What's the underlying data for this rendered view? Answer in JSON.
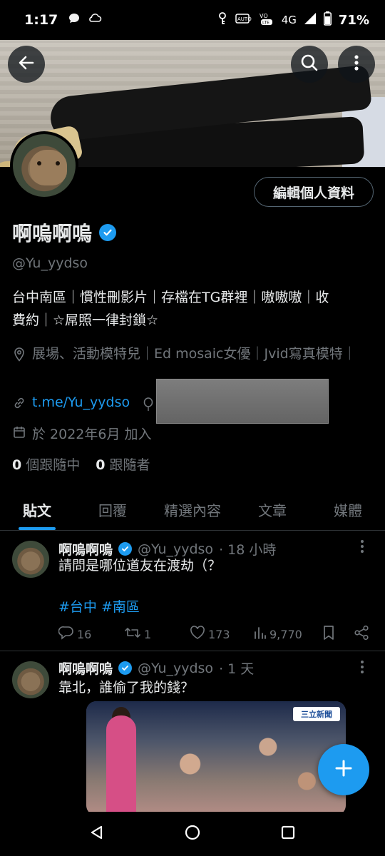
{
  "status_bar": {
    "time": "1:17",
    "network": "4G",
    "battery": "71%",
    "icons": [
      "chat-bubble-icon",
      "cloud-icon",
      "vpn-key-icon",
      "auto-icon",
      "volte-icon",
      "signal-icon",
      "battery-icon"
    ]
  },
  "header": {
    "back_icon": "arrow-left-icon",
    "search_icon": "search-icon",
    "more_icon": "more-vertical-icon"
  },
  "profile": {
    "edit_button": "編輯個人資料",
    "name": "啊嗚啊嗚",
    "handle": "@Yu_yydso",
    "bio_line1": "台中南區｜慣性刪影片｜存檔在TG群裡｜嗷嗷嗷｜收",
    "bio_line2": "費約｜☆屌照一律封鎖☆",
    "location": "展場、活動模特兒｜Ed mosaic女優｜Jvid寫真模特｜",
    "link": "t.me/Yu_yydso",
    "joined": "於 2022年6月 加入",
    "following_count": "0",
    "following_label": "個跟隨中",
    "followers_count": "0",
    "followers_label": "跟隨者"
  },
  "tabs": [
    {
      "label": "貼文",
      "active": true
    },
    {
      "label": "回覆",
      "active": false
    },
    {
      "label": "精選內容",
      "active": false
    },
    {
      "label": "文章",
      "active": false
    },
    {
      "label": "媒體",
      "active": false
    }
  ],
  "posts": [
    {
      "name": "啊嗚啊嗚",
      "handle": "@Yu_yydso",
      "time": "· 18 小時",
      "text": "請問是哪位道友在渡劫（？",
      "hashtags": "#台中 #南區",
      "replies": "16",
      "reposts": "1",
      "likes": "173",
      "views": "9,770"
    },
    {
      "name": "啊嗚啊嗚",
      "handle": "@Yu_yydso",
      "time": "· 1 天",
      "text": "靠北，誰偷了我的錢？",
      "media_logo": "三立新聞"
    }
  ],
  "colors": {
    "accent": "#1d9bf0",
    "background": "#000000",
    "text_primary": "#e7e9ea",
    "text_secondary": "#71767b"
  }
}
